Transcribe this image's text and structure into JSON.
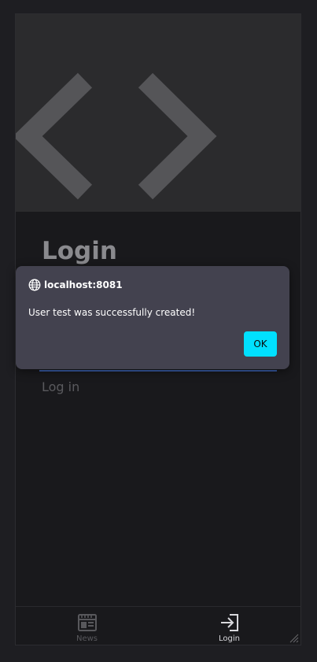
{
  "page": {
    "title": "Login",
    "login_link": "Log in"
  },
  "dialog": {
    "host": "localhost:8081",
    "host_icon": "globe-icon",
    "message": "User test was successfully created!",
    "ok_label": "OK"
  },
  "bottom_nav": {
    "items": [
      {
        "label": "News",
        "icon": "news-icon",
        "active": false
      },
      {
        "label": "Login",
        "icon": "login-icon",
        "active": true
      }
    ]
  },
  "colors": {
    "background": "#1e1e22",
    "surface": "#19191c",
    "hero": "#2b2b2d",
    "dialog": "#43424f",
    "accent": "#00e0ff",
    "input_underline": "#3a5da8"
  }
}
